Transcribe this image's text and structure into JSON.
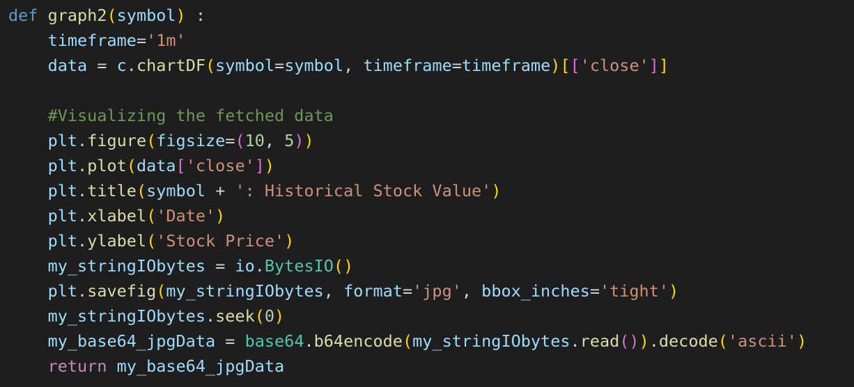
{
  "editor": {
    "language": "python",
    "indent": "    ",
    "colors": {
      "background": "#1e1e1e",
      "keyword": "#569cd6",
      "control": "#c586c0",
      "function": "#dcdcaa",
      "variable": "#9cdcfe",
      "string": "#ce9178",
      "number": "#b5cea8",
      "class": "#4ec9b0",
      "comment": "#6a9955",
      "bracket_level_1": "#ffd700",
      "bracket_level_2": "#da70d6",
      "bracket_level_3": "#179fff"
    },
    "lines": [
      {
        "indent": 0,
        "tokens": [
          {
            "t": "def",
            "c": "kw"
          },
          {
            "t": " ",
            "c": "op"
          },
          {
            "t": "graph2",
            "c": "fn"
          },
          {
            "t": "(",
            "c": "p1"
          },
          {
            "t": "symbol",
            "c": "var"
          },
          {
            "t": ")",
            "c": "p1"
          },
          {
            "t": " :",
            "c": "op"
          }
        ]
      },
      {
        "indent": 1,
        "tokens": [
          {
            "t": "timeframe",
            "c": "var"
          },
          {
            "t": "=",
            "c": "op"
          },
          {
            "t": "'1m'",
            "c": "str"
          }
        ]
      },
      {
        "indent": 1,
        "tokens": [
          {
            "t": "data",
            "c": "var"
          },
          {
            "t": " = ",
            "c": "op"
          },
          {
            "t": "c",
            "c": "var"
          },
          {
            "t": ".",
            "c": "op"
          },
          {
            "t": "chartDF",
            "c": "fn"
          },
          {
            "t": "(",
            "c": "p1"
          },
          {
            "t": "symbol",
            "c": "var"
          },
          {
            "t": "=",
            "c": "op"
          },
          {
            "t": "symbol",
            "c": "var"
          },
          {
            "t": ", ",
            "c": "op"
          },
          {
            "t": "timeframe",
            "c": "var"
          },
          {
            "t": "=",
            "c": "op"
          },
          {
            "t": "timeframe",
            "c": "var"
          },
          {
            "t": ")",
            "c": "p1"
          },
          {
            "t": "[",
            "c": "p1"
          },
          {
            "t": "[",
            "c": "p2"
          },
          {
            "t": "'close'",
            "c": "str"
          },
          {
            "t": "]",
            "c": "p2"
          },
          {
            "t": "]",
            "c": "p1"
          }
        ]
      },
      {
        "indent": 0,
        "tokens": []
      },
      {
        "indent": 1,
        "tokens": [
          {
            "t": "#Visualizing the fetched data",
            "c": "com"
          }
        ]
      },
      {
        "indent": 1,
        "tokens": [
          {
            "t": "plt",
            "c": "var"
          },
          {
            "t": ".",
            "c": "op"
          },
          {
            "t": "figure",
            "c": "fn"
          },
          {
            "t": "(",
            "c": "p1"
          },
          {
            "t": "figsize",
            "c": "var"
          },
          {
            "t": "=",
            "c": "op"
          },
          {
            "t": "(",
            "c": "p2"
          },
          {
            "t": "10",
            "c": "num"
          },
          {
            "t": ", ",
            "c": "op"
          },
          {
            "t": "5",
            "c": "num"
          },
          {
            "t": ")",
            "c": "p2"
          },
          {
            "t": ")",
            "c": "p1"
          }
        ]
      },
      {
        "indent": 1,
        "tokens": [
          {
            "t": "plt",
            "c": "var"
          },
          {
            "t": ".",
            "c": "op"
          },
          {
            "t": "plot",
            "c": "fn"
          },
          {
            "t": "(",
            "c": "p1"
          },
          {
            "t": "data",
            "c": "var"
          },
          {
            "t": "[",
            "c": "p2"
          },
          {
            "t": "'close'",
            "c": "str"
          },
          {
            "t": "]",
            "c": "p2"
          },
          {
            "t": ")",
            "c": "p1"
          }
        ]
      },
      {
        "indent": 1,
        "tokens": [
          {
            "t": "plt",
            "c": "var"
          },
          {
            "t": ".",
            "c": "op"
          },
          {
            "t": "title",
            "c": "fn"
          },
          {
            "t": "(",
            "c": "p1"
          },
          {
            "t": "symbol",
            "c": "var"
          },
          {
            "t": " + ",
            "c": "op"
          },
          {
            "t": "': Historical Stock Value'",
            "c": "str"
          },
          {
            "t": ")",
            "c": "p1"
          }
        ]
      },
      {
        "indent": 1,
        "tokens": [
          {
            "t": "plt",
            "c": "var"
          },
          {
            "t": ".",
            "c": "op"
          },
          {
            "t": "xlabel",
            "c": "fn"
          },
          {
            "t": "(",
            "c": "p1"
          },
          {
            "t": "'Date'",
            "c": "str"
          },
          {
            "t": ")",
            "c": "p1"
          }
        ]
      },
      {
        "indent": 1,
        "tokens": [
          {
            "t": "plt",
            "c": "var"
          },
          {
            "t": ".",
            "c": "op"
          },
          {
            "t": "ylabel",
            "c": "fn"
          },
          {
            "t": "(",
            "c": "p1"
          },
          {
            "t": "'Stock Price'",
            "c": "str"
          },
          {
            "t": ")",
            "c": "p1"
          }
        ]
      },
      {
        "indent": 1,
        "tokens": [
          {
            "t": "my_stringIObytes",
            "c": "var"
          },
          {
            "t": " = ",
            "c": "op"
          },
          {
            "t": "io",
            "c": "var"
          },
          {
            "t": ".",
            "c": "op"
          },
          {
            "t": "BytesIO",
            "c": "cls"
          },
          {
            "t": "(",
            "c": "p1"
          },
          {
            "t": ")",
            "c": "p1"
          }
        ]
      },
      {
        "indent": 1,
        "tokens": [
          {
            "t": "plt",
            "c": "var"
          },
          {
            "t": ".",
            "c": "op"
          },
          {
            "t": "savefig",
            "c": "fn"
          },
          {
            "t": "(",
            "c": "p1"
          },
          {
            "t": "my_stringIObytes",
            "c": "var"
          },
          {
            "t": ", ",
            "c": "op"
          },
          {
            "t": "format",
            "c": "var"
          },
          {
            "t": "=",
            "c": "op"
          },
          {
            "t": "'jpg'",
            "c": "str"
          },
          {
            "t": ", ",
            "c": "op"
          },
          {
            "t": "bbox_inches",
            "c": "var"
          },
          {
            "t": "=",
            "c": "op"
          },
          {
            "t": "'tight'",
            "c": "str"
          },
          {
            "t": ")",
            "c": "p1"
          }
        ]
      },
      {
        "indent": 1,
        "tokens": [
          {
            "t": "my_stringIObytes",
            "c": "var"
          },
          {
            "t": ".",
            "c": "op"
          },
          {
            "t": "seek",
            "c": "fn"
          },
          {
            "t": "(",
            "c": "p1"
          },
          {
            "t": "0",
            "c": "num"
          },
          {
            "t": ")",
            "c": "p1"
          }
        ]
      },
      {
        "indent": 1,
        "tokens": [
          {
            "t": "my_base64_jpgData",
            "c": "var"
          },
          {
            "t": " = ",
            "c": "op"
          },
          {
            "t": "base64",
            "c": "cls"
          },
          {
            "t": ".",
            "c": "op"
          },
          {
            "t": "b64encode",
            "c": "fn"
          },
          {
            "t": "(",
            "c": "p1"
          },
          {
            "t": "my_stringIObytes",
            "c": "var"
          },
          {
            "t": ".",
            "c": "op"
          },
          {
            "t": "read",
            "c": "fn"
          },
          {
            "t": "(",
            "c": "p2"
          },
          {
            "t": ")",
            "c": "p2"
          },
          {
            "t": ")",
            "c": "p1"
          },
          {
            "t": ".",
            "c": "op"
          },
          {
            "t": "decode",
            "c": "fn"
          },
          {
            "t": "(",
            "c": "p1"
          },
          {
            "t": "'ascii'",
            "c": "str"
          },
          {
            "t": ")",
            "c": "p1"
          }
        ]
      },
      {
        "indent": 1,
        "tokens": [
          {
            "t": "return",
            "c": "ctl"
          },
          {
            "t": " ",
            "c": "op"
          },
          {
            "t": "my_base64_jpgData",
            "c": "var"
          }
        ]
      }
    ]
  }
}
